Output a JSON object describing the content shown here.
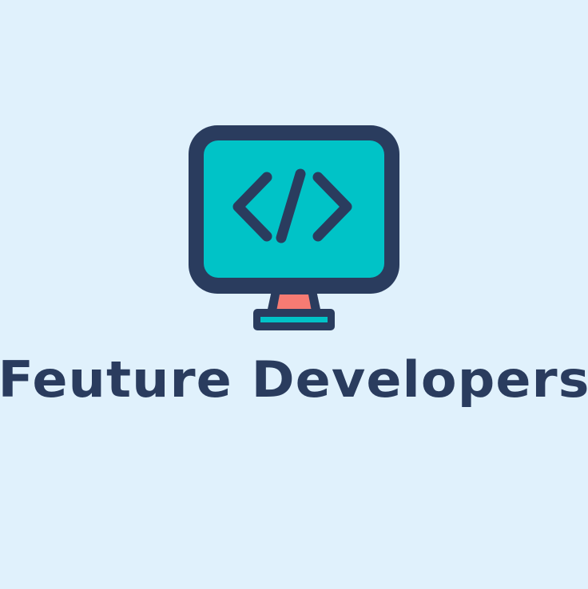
{
  "logo": {
    "brand_name": "Feuture Developers",
    "icon": "monitor-code-icon",
    "code_glyph": "</>"
  },
  "colors": {
    "background": "#E0F1FC",
    "outline": "#2A3C5E",
    "screen": "#00C3C7",
    "stand": "#F67B73",
    "base_inner": "#00C3C7"
  }
}
